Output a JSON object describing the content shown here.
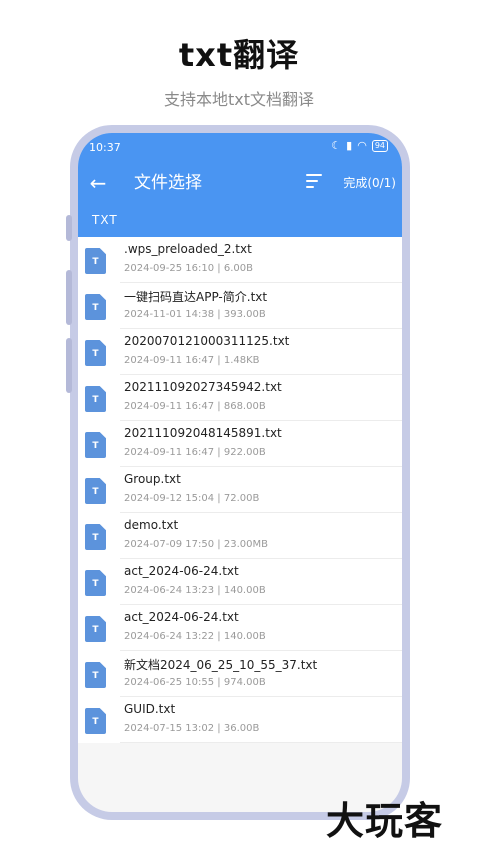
{
  "promo": {
    "title": "txt翻译",
    "subtitle": "支持本地txt文档翻译"
  },
  "status_bar": {
    "time": "10:37",
    "icons": [
      "moon-icon",
      "signal-icon",
      "wifi-icon",
      "battery-icon"
    ],
    "battery": "94"
  },
  "app_bar": {
    "back_icon": "arrow-left-icon",
    "title": "文件选择",
    "sort_icon": "sort-icon",
    "done_label": "完成(0/1)",
    "tab_label": "TXT",
    "accent_color": "#4a95f2"
  },
  "files": [
    {
      "icon": "T",
      "name": ".wps_preloaded_2.txt",
      "meta": "2024-09-25 16:10 | 6.00B"
    },
    {
      "icon": "T",
      "name": "一键扫码直达APP-简介.txt",
      "meta": "2024-11-01 14:38 | 393.00B"
    },
    {
      "icon": "T",
      "name": "2020070121000311125.txt",
      "meta": "2024-09-11 16:47 | 1.48KB"
    },
    {
      "icon": "T",
      "name": "202111092027345942.txt",
      "meta": "2024-09-11 16:47 | 868.00B"
    },
    {
      "icon": "T",
      "name": "202111092048145891.txt",
      "meta": "2024-09-11 16:47 | 922.00B"
    },
    {
      "icon": "T",
      "name": "Group.txt",
      "meta": "2024-09-12 15:04 | 72.00B"
    },
    {
      "icon": "T",
      "name": "demo.txt",
      "meta": "2024-07-09 17:50 | 23.00MB"
    },
    {
      "icon": "T",
      "name": "act_2024-06-24.txt",
      "meta": "2024-06-24 13:23 | 140.00B"
    },
    {
      "icon": "T",
      "name": "act_2024-06-24.txt",
      "meta": "2024-06-24 13:22 | 140.00B"
    },
    {
      "icon": "T",
      "name": "新文档2024_06_25_10_55_37.txt",
      "meta": "2024-06-25 10:55 | 974.00B"
    },
    {
      "icon": "T",
      "name": "GUID.txt",
      "meta": "2024-07-15 13:02 | 36.00B"
    }
  ],
  "watermark": "大玩客"
}
